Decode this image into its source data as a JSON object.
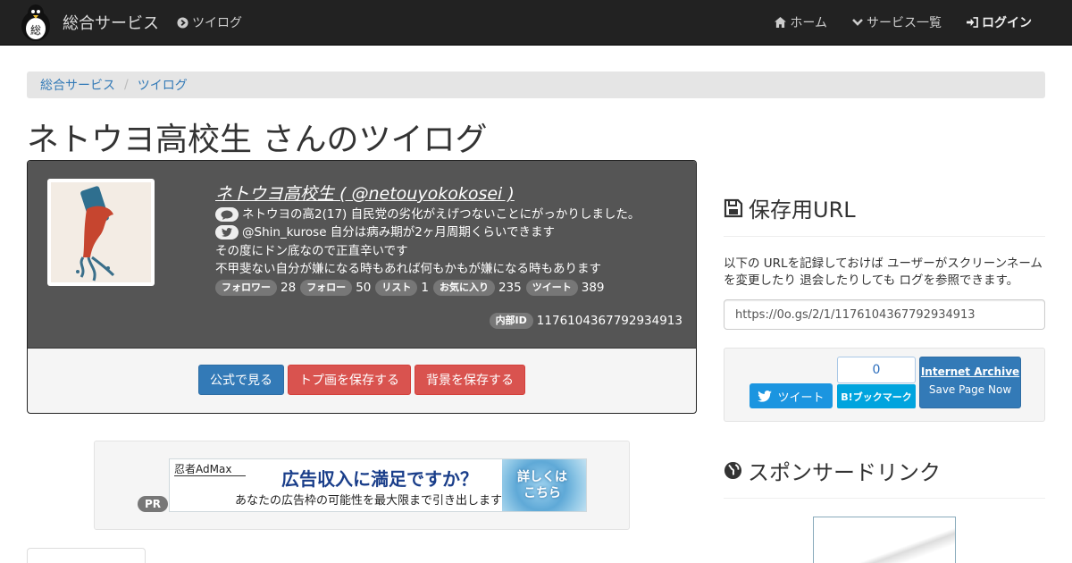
{
  "navbar": {
    "brand": "総合サービス",
    "brand_logo_glyph": "総",
    "left_link": "ツイログ",
    "right_links": [
      {
        "label": "ホーム",
        "icon": "home-icon"
      },
      {
        "label": "サービス一覧",
        "icon": "chevron-down-icon"
      },
      {
        "label": "ログイン",
        "icon": "sign-in-icon"
      }
    ]
  },
  "breadcrumb": [
    "総合サービス",
    "ツイログ"
  ],
  "page_title": "ネトウヨ高校生 さんのツイログ",
  "profile": {
    "name": "ネトウヨ高校生 ( @netouyokokosei )",
    "bio_lines": [
      "ネトウヨの高2(17) 自民党の劣化がえげつないことにがっかりしました。",
      "@Shin_kurose 自分は病み期が2ヶ月周期くらいできます",
      "その度にドン底なので正直辛いです",
      "不甲斐ない自分が嫌になる時もあれば何もかもが嫌になる時もあります"
    ],
    "stats": [
      {
        "label": "フォロワー",
        "value": "28"
      },
      {
        "label": "フォロー",
        "value": "50"
      },
      {
        "label": "リスト",
        "value": "1"
      },
      {
        "label": "お気に入り",
        "value": "235"
      },
      {
        "label": "ツイート",
        "value": "389"
      }
    ],
    "internal_id_label": "内部ID",
    "internal_id": "1176104367792934913",
    "buttons": {
      "official": "公式で見る",
      "save_icon": "トプ画を保存する",
      "save_bg": "背景を保存する"
    }
  },
  "ad": {
    "pr_label": "PR",
    "brand": "忍者AdMax",
    "headline": "広告収入に満足ですか？",
    "sub": "あなたの広告枠の可能性を最大限まで引き出します",
    "cta_line1": "詳しくは",
    "cta_line2": "こちら"
  },
  "side": {
    "save_title": "保存用URL",
    "save_desc": "以下の URLを記録しておけば ユーザーがスクリーンネームを変更したり 退会したりしても ログを参照できます。",
    "url": "https://0o.gs/2/1/1176104367792934913",
    "tweet_label": "ツイート",
    "hatena_count": "0",
    "hatena_label": "B!ブックマーク",
    "ia_title": "Internet Archive",
    "ia_sub": "Save Page Now",
    "sponsor_title": "スポンサードリンク"
  },
  "colors": {
    "navbar": "#222222",
    "primary": "#337ab7",
    "danger": "#d9534f",
    "twitter": "#1b95e0",
    "hatena": "#00a4de"
  }
}
